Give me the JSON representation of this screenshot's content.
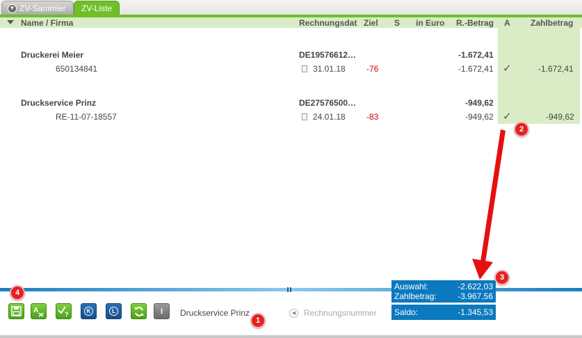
{
  "tabs": [
    {
      "label": "ZV-Sammler"
    },
    {
      "label": "ZV-Liste"
    }
  ],
  "columns": {
    "name": "Name / Firma",
    "rechnungsdatum": "Rechnungsdat",
    "ziel": "Ziel",
    "s": "S",
    "in_euro": "in Euro",
    "r_betrag": "R.-Betrag",
    "a": "A",
    "zahlbetrag": "Zahlbetrag"
  },
  "rows": [
    {
      "firma": "Druckerei Meier",
      "iban": "DE19576612…",
      "total": "-1.672,41",
      "rechnungsnummer": "650134841",
      "datum": "31.01.18",
      "ziel": "-76",
      "r_betrag": "-1.672,41",
      "zahlbetrag": "-1.672,41"
    },
    {
      "firma": "Druckservice Prinz",
      "iban": "DE27576500…",
      "total": "-949,62",
      "rechnungsnummer": "RE-11-07-18557",
      "datum": "24.01.18",
      "ziel": "-83",
      "r_betrag": "-949,62",
      "zahlbetrag": "-949,62"
    }
  ],
  "status": {
    "selected_name": "Druckservice Prinz",
    "sort_label": "Rechnungsnummer"
  },
  "toolbar": {
    "btn_k": "K",
    "btn_l": "L",
    "btn_i": "I"
  },
  "summary": {
    "auswahl_label": "Auswahl:",
    "auswahl_value": "-2.622,03",
    "zahlbetrag_label": "Zahlbetrag:",
    "zahlbetrag_value": "-3.967,56",
    "saldo_label": "Saldo:",
    "saldo_value": "-1.345,53"
  },
  "badges": [
    "1",
    "2",
    "3",
    "4"
  ],
  "colors": {
    "accent_green": "#6fbf2a",
    "header_green": "#d9ecc5",
    "summary_blue": "#0b79be",
    "badge_red": "#e32222",
    "negative_red": "#cc0000"
  }
}
